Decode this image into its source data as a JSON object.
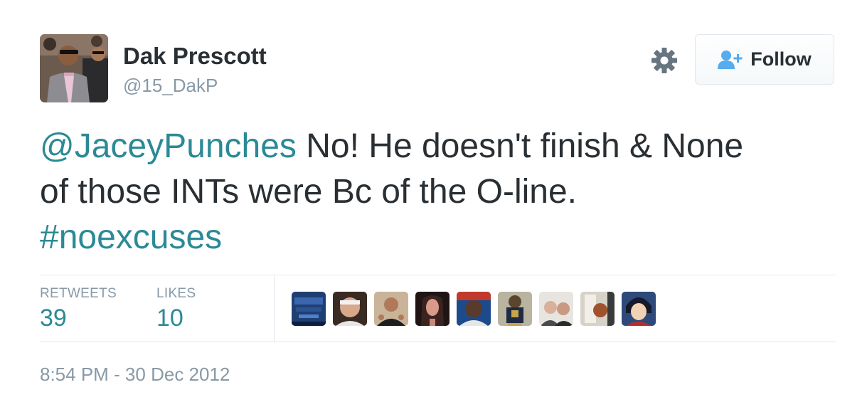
{
  "profile": {
    "name": "Dak Prescott",
    "handle": "@15_DakP"
  },
  "actions": {
    "follow_label": "Follow"
  },
  "tweet": {
    "mention": "@JaceyPunches",
    "text_line1": " No! He doesn't finish & None",
    "text_line2": "of those INTs were Bc of the O-line.",
    "hashtag": "#noexcuses"
  },
  "stats": {
    "retweets_label": "RETWEETS",
    "retweets_value": "39",
    "likes_label": "LIKES",
    "likes_value": "10"
  },
  "liker_thumbnail_count": 9,
  "timestamp": "8:54 PM - 30 Dec 2012",
  "colors": {
    "link": "#2b8a95",
    "text": "#292f33",
    "muted": "#8899a6",
    "divider": "#e1e8ed",
    "follow_icon": "#55acee"
  }
}
